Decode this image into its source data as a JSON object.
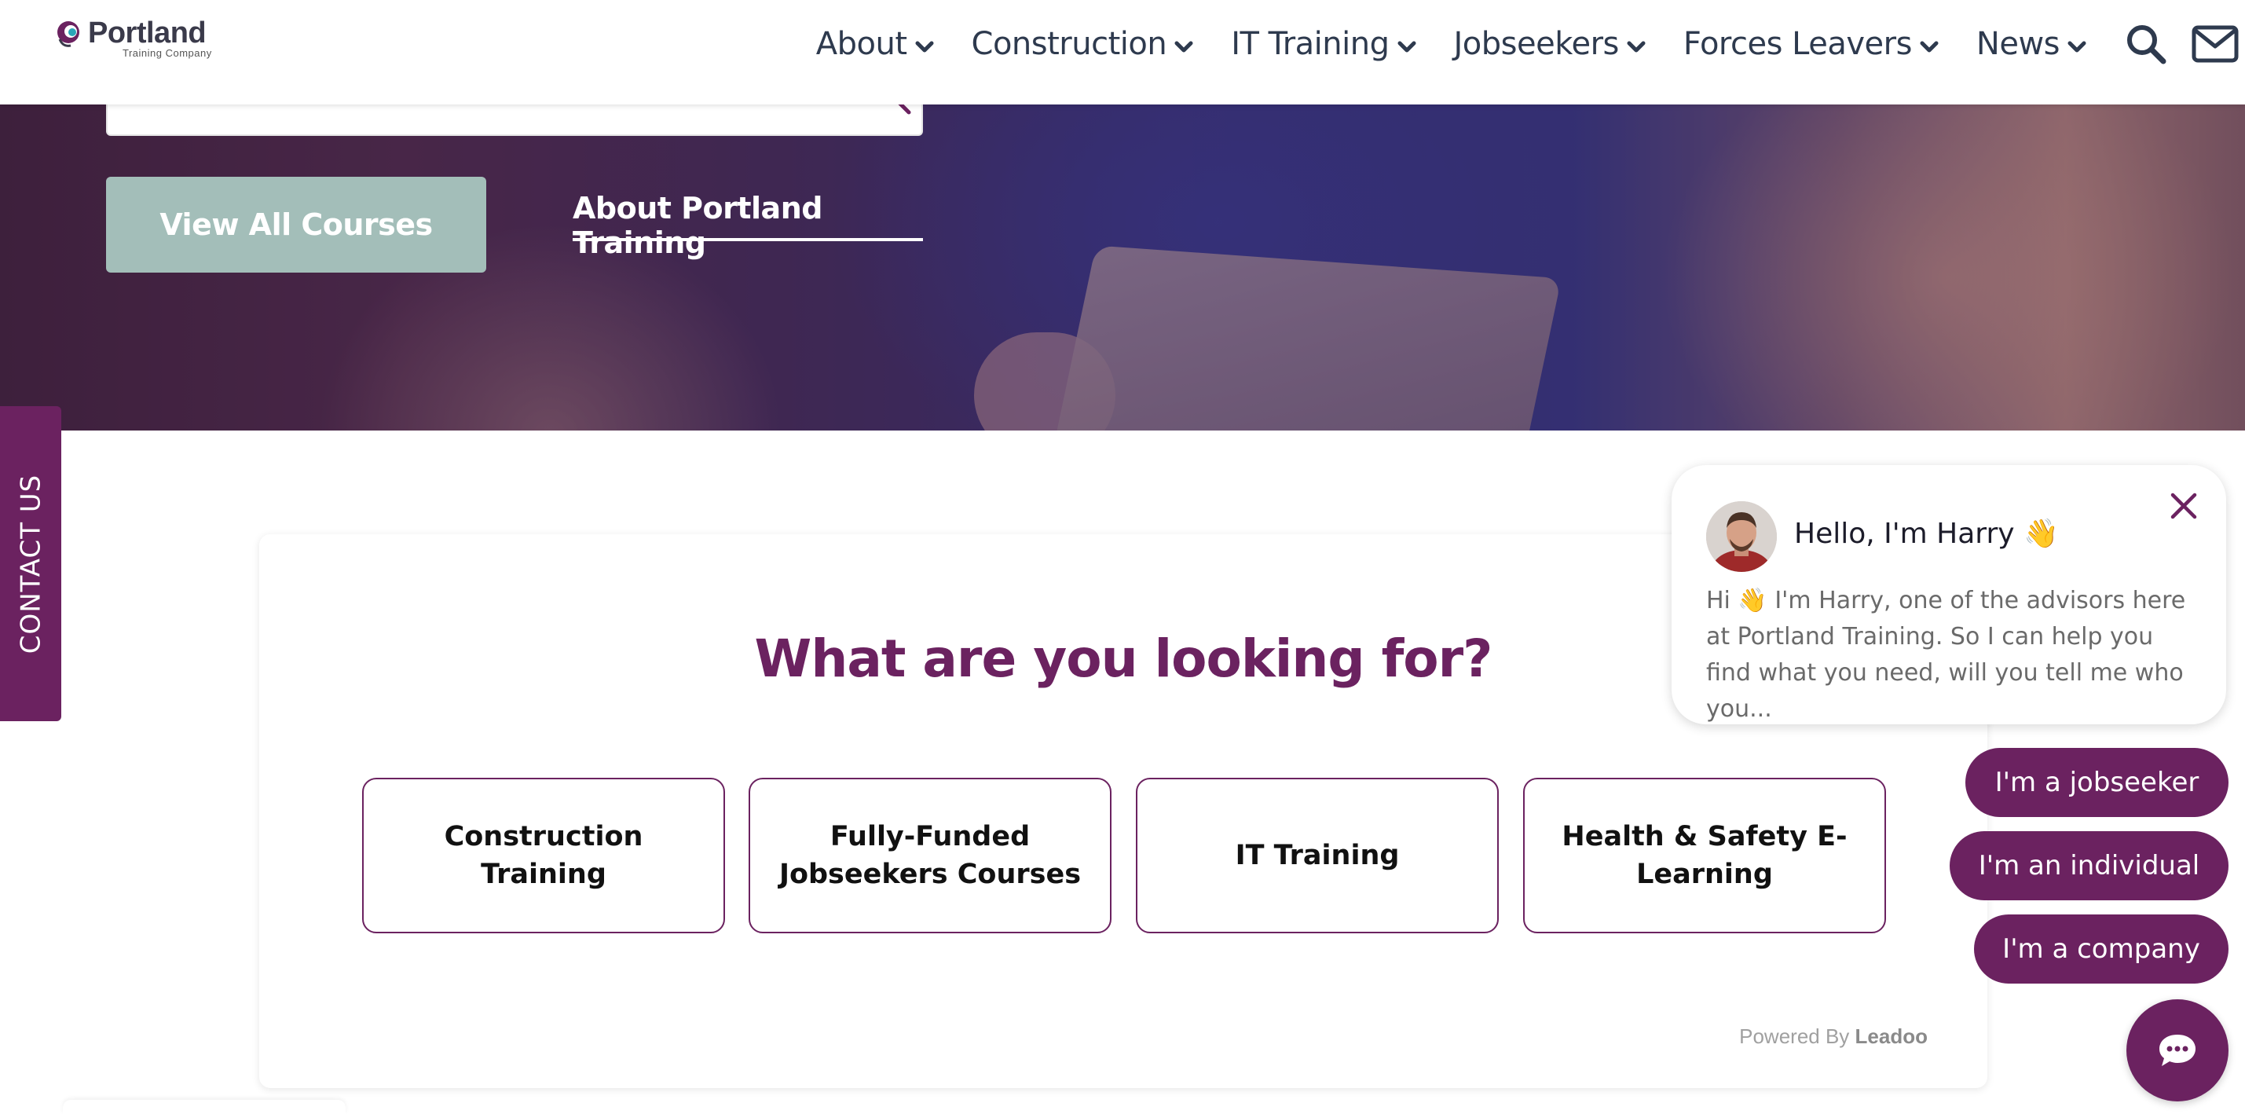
{
  "header": {
    "logo_name": "Portland",
    "logo_sub": "Training Company",
    "nav": [
      {
        "label": "About"
      },
      {
        "label": "Construction"
      },
      {
        "label": "IT Training"
      },
      {
        "label": "Jobseekers"
      },
      {
        "label": "Forces Leavers"
      },
      {
        "label": "News"
      }
    ],
    "icons": [
      "search-icon",
      "mail-icon"
    ]
  },
  "hero": {
    "primary_button": "View All Courses",
    "secondary_link": "About Portland Training"
  },
  "contact_tab": "CONTACT US",
  "finder": {
    "title": "What are you looking for?",
    "options": [
      {
        "label": "Construction Training"
      },
      {
        "label": "Fully-Funded Jobseekers Courses"
      },
      {
        "label": "IT Training"
      },
      {
        "label": "Health & Safety E-Learning"
      }
    ],
    "powered_prefix": "Powered By",
    "powered_brand": "Leadoo"
  },
  "chat": {
    "name": "Hello, I'm Harry 👋",
    "message": "Hi 👋 I'm Harry, one of the advisors here at Portland Training. So I can help you find what you need, will you tell me who you...",
    "options": [
      {
        "label": "I'm a jobseeker"
      },
      {
        "label": "I'm an individual"
      },
      {
        "label": "I'm a company"
      }
    ]
  },
  "colors": {
    "brand_purple": "#6b2260",
    "sage_button": "#a3beb9",
    "nav_text": "#2e3a4e"
  }
}
